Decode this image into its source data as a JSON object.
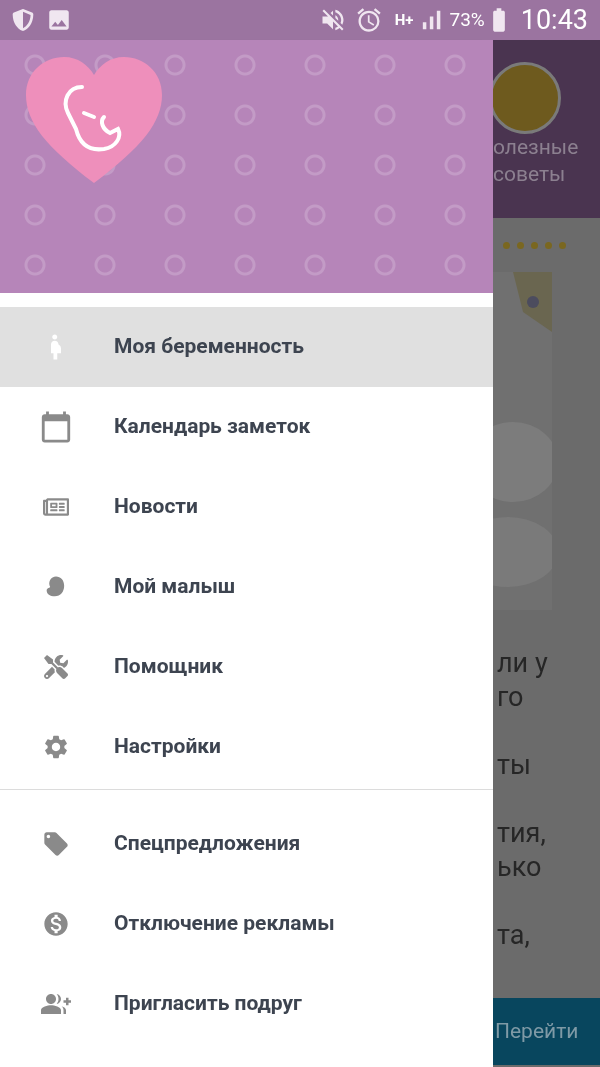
{
  "status_bar": {
    "network": "H+",
    "battery": "73%",
    "time": "10:43"
  },
  "background_screen": {
    "tab_label": [
      "олезные",
      "советы"
    ],
    "text_lines": [
      "ли у",
      "го",
      "ты",
      "тия,",
      "ько",
      "та,"
    ],
    "button": "Перейти"
  },
  "drawer": {
    "sections": [
      {
        "items": [
          {
            "label": "Моя беременность",
            "selected": true
          },
          {
            "label": "Календарь заметок",
            "selected": false
          },
          {
            "label": "Новости",
            "selected": false
          },
          {
            "label": "Мой малыш",
            "selected": false
          },
          {
            "label": "Помощник",
            "selected": false
          },
          {
            "label": "Настройки",
            "selected": false
          }
        ]
      },
      {
        "items": [
          {
            "label": "Спецпредложения",
            "selected": false
          },
          {
            "label": "Отключение рекламы",
            "selected": false
          },
          {
            "label": "Пригласить подруг",
            "selected": false
          }
        ]
      }
    ]
  }
}
